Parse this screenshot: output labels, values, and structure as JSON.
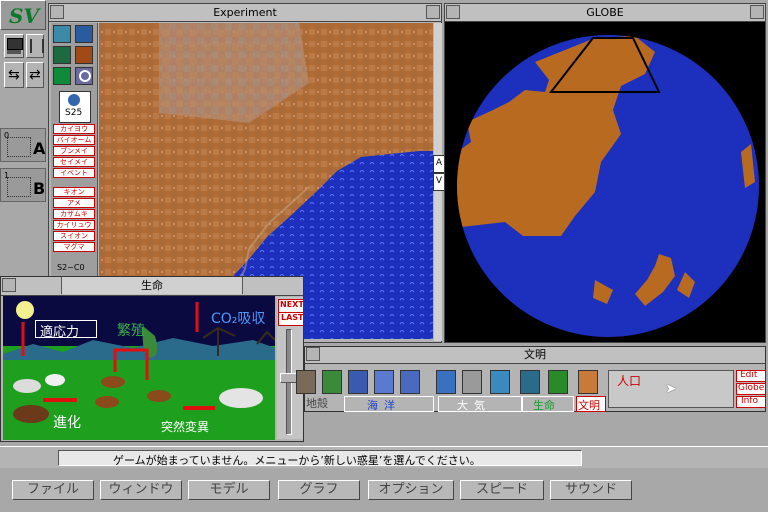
{
  "windows": {
    "experiment_title": "Experiment",
    "globe_title": "GLOBE",
    "life_title": "生命",
    "civ_title": "文明"
  },
  "colors": {
    "ocean": "#1c2fbd",
    "land": "#b86a20",
    "desktop": "#a8a8a8",
    "accent_red": "#c00000"
  },
  "logo_text": "SV",
  "tool_panel": {
    "counter_label": "S25",
    "bottom_label": "S2~C0",
    "tabs_top": [
      "カイヨウ",
      "バイオーム",
      "ブンメイ",
      "セイメイ",
      "イベント"
    ],
    "tabs_bottom": [
      "キオン",
      "アメ",
      "カザムキ",
      "カイリュウ",
      "スイオン",
      "マグマ"
    ]
  },
  "side_slots": [
    {
      "number": "0",
      "letter": "A"
    },
    {
      "number": "1",
      "letter": "B"
    }
  ],
  "experiment": {
    "scroll_up": "A",
    "scroll_down": "V"
  },
  "life_panel": {
    "labels": {
      "adapt": "適応力",
      "breed": "繁殖",
      "co2": "CO₂吸収",
      "evolve": "進化",
      "mutation": "突然変異"
    },
    "next_label": "NEXT",
    "last_label": "LAST"
  },
  "civ_panel": {
    "group_labels": [
      "地殻",
      "海洋",
      "大気",
      "生命",
      "文明"
    ],
    "population_label": "人口",
    "buttons": [
      "Edit",
      "Globe",
      "Info"
    ]
  },
  "status": {
    "message": "ゲームが始まっていません。メニューから’新しい惑星’を選んでください。"
  },
  "menu": [
    "ファイル",
    "ウィンドウ",
    "モデル",
    "グラフ",
    "オプション",
    "スピード",
    "サウンド"
  ]
}
